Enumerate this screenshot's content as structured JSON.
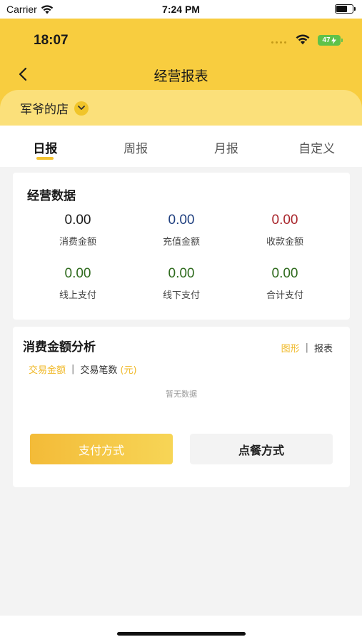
{
  "sim_status": {
    "carrier": "Carrier",
    "time": "7:24 PM"
  },
  "inner_status": {
    "time": "18:07",
    "battery": "47"
  },
  "header": {
    "title": "经营报表",
    "store_name": "军爷的店"
  },
  "tabs": [
    {
      "label": "日报",
      "active": true
    },
    {
      "label": "周报",
      "active": false
    },
    {
      "label": "月报",
      "active": false
    },
    {
      "label": "自定义",
      "active": false
    }
  ],
  "business_data": {
    "title": "经营数据",
    "metrics": [
      {
        "value": "0.00",
        "label": "消费金额",
        "color": "#1a1a1a"
      },
      {
        "value": "0.00",
        "label": "充值金额",
        "color": "#1f3f7f"
      },
      {
        "value": "0.00",
        "label": "收款金额",
        "color": "#a8242a"
      },
      {
        "value": "0.00",
        "label": "线上支付",
        "color": "#2f6b1e"
      },
      {
        "value": "0.00",
        "label": "线下支付",
        "color": "#2f6b1e"
      },
      {
        "value": "0.00",
        "label": "合计支付",
        "color": "#2f6b1e"
      }
    ]
  },
  "analysis": {
    "title": "消费金额分析",
    "view_chart": "图形",
    "view_table": "报表",
    "legend_amount": "交易金额",
    "legend_count": "交易笔数",
    "legend_unit": "(元)",
    "empty_text": "暂无数据",
    "btn_payment": "支付方式",
    "btn_order": "点餐方式"
  },
  "colors": {
    "header_yellow": "#f8cd3f",
    "accent": "#f0b928"
  }
}
